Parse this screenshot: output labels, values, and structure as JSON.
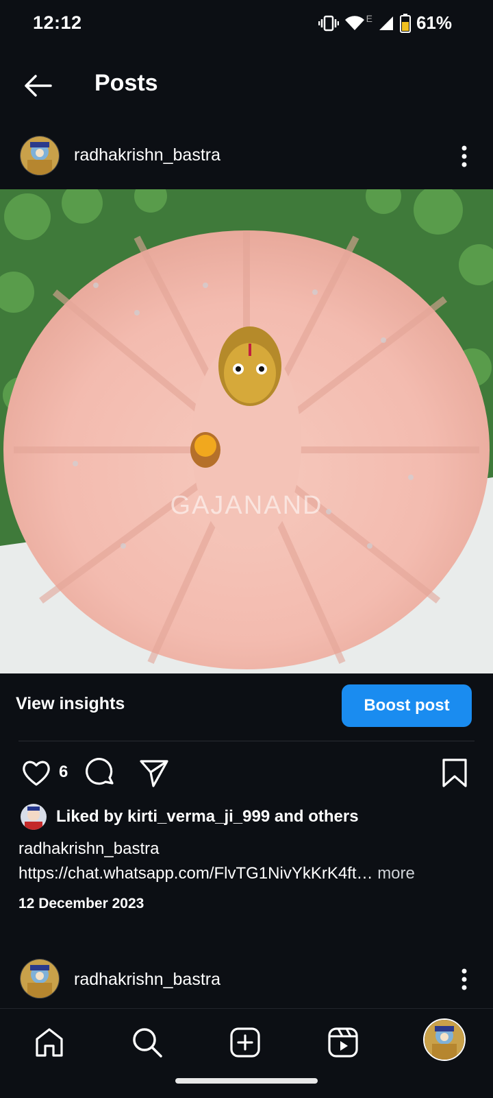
{
  "status_bar": {
    "time": "12:12",
    "network": "E",
    "battery": "61%",
    "icons": [
      "vibrate-icon",
      "wifi-icon",
      "signal-icon",
      "battery-icon"
    ]
  },
  "header": {
    "title": "Posts",
    "back_icon": "arrow-left-icon"
  },
  "post": {
    "username": "radhakrishn_bastra",
    "image_watermark": "GAJANAND",
    "insights_label": "View insights",
    "boost_label": "Boost post",
    "like_count": "6",
    "liked_by": "Liked by kirti_verma_ji_999 and others",
    "caption_username": "radhakrishn_bastra",
    "caption_link": "https://chat.whatsapp.com/FlvTG1NivYkKrK4ft…",
    "caption_more": "more",
    "date": "12 December 2023",
    "actions": [
      "heart-icon",
      "comment-icon",
      "share-icon",
      "bookmark-icon"
    ]
  },
  "next_post": {
    "username": "radhakrishn_bastra"
  },
  "bottom_nav": {
    "items": [
      "home-icon",
      "search-icon",
      "create-icon",
      "reels-icon",
      "profile-avatar"
    ]
  },
  "colors": {
    "background": "#0c0f14",
    "accent": "#1a8cf0",
    "text": "#ffffff"
  }
}
